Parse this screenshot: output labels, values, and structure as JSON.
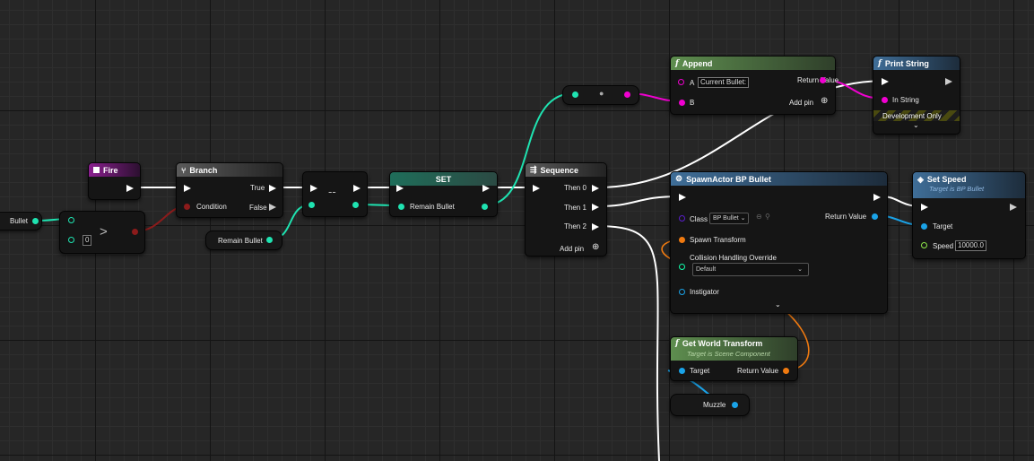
{
  "app": "Unreal Engine Blueprint Graph",
  "colors": {
    "exec": "#ffffff",
    "bool": "#8c1b1b",
    "int": "#1fe3b1",
    "string": "#f000d0",
    "object": "#1aa3e8",
    "class": "#5a1ecc",
    "transform": "#f07a10",
    "vector": "#f3c21d"
  },
  "nodes": {
    "bullet_var": {
      "label": "Bullet"
    },
    "greater": {
      "op": ">",
      "input_b": "0"
    },
    "fire": {
      "title": "Fire"
    },
    "branch": {
      "title": "Branch",
      "condition": "Condition",
      "true_label": "True",
      "false_label": "False"
    },
    "remain_bullet_get": {
      "label": "Remain Bullet"
    },
    "decrement": {
      "op": "--"
    },
    "set": {
      "title": "SET",
      "pin": "Remain Bullet"
    },
    "sequence": {
      "title": "Sequence",
      "then0": "Then 0",
      "then1": "Then 1",
      "then2": "Then 2",
      "add_pin": "Add pin"
    },
    "append": {
      "title": "Append",
      "a_label": "A",
      "a_value": "Current Bullet:",
      "b_label": "B",
      "return_value": "Return Value",
      "add_pin": "Add pin"
    },
    "print_string": {
      "title": "Print String",
      "in_string": "In String",
      "dev_only": "Development Only"
    },
    "spawn_actor": {
      "title": "SpawnActor BP Bullet",
      "class_label": "Class",
      "class_value": "BP Bullet",
      "return_value": "Return Value",
      "spawn_transform": "Spawn Transform",
      "collision": "Collision Handling Override",
      "collision_value": "Default",
      "instigator": "Instigator"
    },
    "set_speed": {
      "title": "Set Speed",
      "subtitle": "Target is BP Bullet",
      "target": "Target",
      "speed": "Speed",
      "speed_value": "10000.0"
    },
    "get_world_transform": {
      "title": "Get World Transform",
      "subtitle": "Target is Scene Component",
      "target": "Target",
      "return_value": "Return Value"
    },
    "muzzle": {
      "label": "Muzzle"
    }
  }
}
